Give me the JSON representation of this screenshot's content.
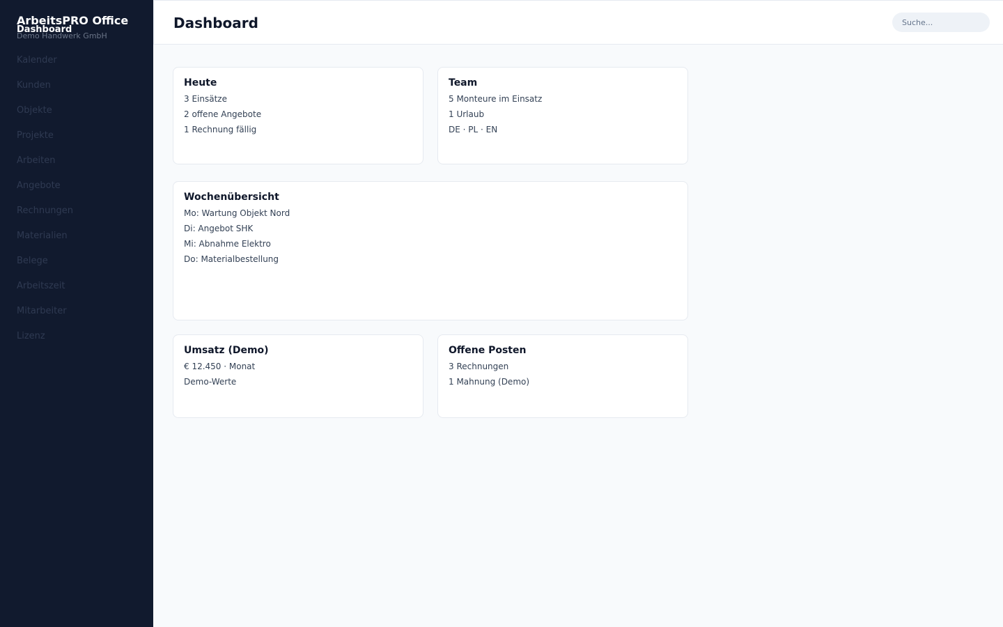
{
  "app": {
    "name": "ArbeitsPRO Office",
    "active_section": "Dashboard",
    "company": "Demo Handwerk GmbH"
  },
  "sidebar": {
    "items": [
      {
        "label": "Kalender"
      },
      {
        "label": "Kunden"
      },
      {
        "label": "Objekte"
      },
      {
        "label": "Projekte"
      },
      {
        "label": "Arbeiten"
      },
      {
        "label": "Angebote"
      },
      {
        "label": "Rechnungen"
      },
      {
        "label": "Materialien"
      },
      {
        "label": "Belege"
      },
      {
        "label": "Arbeitszeit"
      },
      {
        "label": "Mitarbeiter"
      },
      {
        "label": "Lizenz"
      }
    ]
  },
  "header": {
    "title": "Dashboard",
    "search_placeholder": "Suche..."
  },
  "cards": {
    "heute": {
      "title": "Heute",
      "lines": [
        "3 Einsätze",
        "2 offene Angebote",
        "1 Rechnung fällig"
      ]
    },
    "team": {
      "title": "Team",
      "lines": [
        "5 Monteure im Einsatz",
        "1 Urlaub",
        "DE · PL · EN"
      ]
    },
    "woche": {
      "title": "Wochenübersicht",
      "lines": [
        "Mo: Wartung Objekt Nord",
        "Di: Angebot SHK",
        "Mi: Abnahme Elektro",
        "Do: Materialbestellung"
      ]
    },
    "umsatz": {
      "title": "Umsatz (Demo)",
      "lines": [
        "€ 12.450 · Monat",
        "Demo-Werte"
      ]
    },
    "offen": {
      "title": "Offene Posten",
      "lines": [
        "3 Rechnungen",
        "1 Mahnung (Demo)"
      ]
    }
  },
  "colors": {
    "sidebar_bg": "#111a2e",
    "content_bg": "#f8fafc",
    "card_bg": "#ffffff",
    "text_primary": "#0f172a"
  }
}
